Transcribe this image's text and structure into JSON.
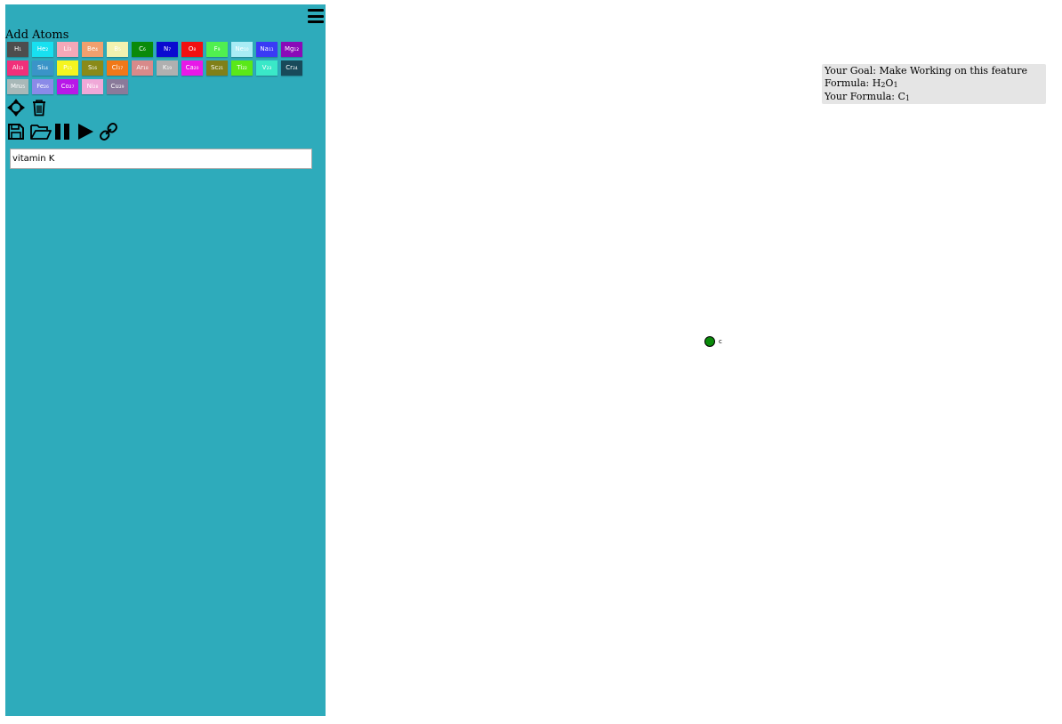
{
  "sidebar": {
    "background": "#2eabbb",
    "add_atoms_title": "Add Atoms",
    "atom_rows": [
      [
        {
          "label": "H₁",
          "bg": "#4d4d4d",
          "fg": "#ffffff"
        },
        {
          "label": "He₂",
          "bg": "#18e0f0",
          "fg": "#ffffff"
        },
        {
          "label": "Li₃",
          "bg": "#f5a8b8",
          "fg": "#ffffff"
        },
        {
          "label": "Be₄",
          "bg": "#f2a06e",
          "fg": "#ffffff"
        },
        {
          "label": "B₅",
          "bg": "#f2f2b0",
          "fg": "#ffffff"
        },
        {
          "label": "C₆",
          "bg": "#0a8a0a",
          "fg": "#ffffff"
        },
        {
          "label": "N₇",
          "bg": "#0a0ad0",
          "fg": "#ffffff"
        },
        {
          "label": "O₈",
          "bg": "#f01010",
          "fg": "#ffffff"
        },
        {
          "label": "F₉",
          "bg": "#50f050",
          "fg": "#ffffff"
        },
        {
          "label": "Ne₁₀",
          "bg": "#a8ecf5",
          "fg": "#ffffff"
        },
        {
          "label": "Na₁₁",
          "bg": "#3a3af5",
          "fg": "#ffffff"
        },
        {
          "label": "Mg₁₂",
          "bg": "#8a0ab8",
          "fg": "#ffffff"
        }
      ],
      [
        {
          "label": "Al₁₃",
          "bg": "#f0307a",
          "fg": "#ffffff"
        },
        {
          "label": "Si₁₄",
          "bg": "#3a94c8",
          "fg": "#ffffff"
        },
        {
          "label": "P₁₅",
          "bg": "#f5f520",
          "fg": "#ffffff"
        },
        {
          "label": "S₁₆",
          "bg": "#8a8a18",
          "fg": "#ffffff"
        },
        {
          "label": "Cl₁₇",
          "bg": "#f07818",
          "fg": "#ffffff"
        },
        {
          "label": "Ar₁₈",
          "bg": "#d88a8a",
          "fg": "#ffffff"
        },
        {
          "label": "K₁₉",
          "bg": "#b0b0b0",
          "fg": "#ffffff"
        },
        {
          "label": "Ca₂₀",
          "bg": "#e818e8",
          "fg": "#ffffff"
        },
        {
          "label": "Sc₂₁",
          "bg": "#808018",
          "fg": "#ffffff"
        },
        {
          "label": "Ti₂₂",
          "bg": "#5ae818",
          "fg": "#ffffff"
        },
        {
          "label": "V₂₃",
          "bg": "#3ae8c8",
          "fg": "#ffffff"
        },
        {
          "label": "Cr₂₄",
          "bg": "#184a5a",
          "fg": "#ffffff"
        }
      ],
      [
        {
          "label": "Mn₂₅",
          "bg": "#a8b8b8",
          "fg": "#ffffff"
        },
        {
          "label": "Fe₂₆",
          "bg": "#8a8ae8",
          "fg": "#ffffff"
        },
        {
          "label": "Co₂₇",
          "bg": "#b818e8",
          "fg": "#ffffff"
        },
        {
          "label": "Ni₂₈",
          "bg": "#f0a8d8",
          "fg": "#ffffff"
        },
        {
          "label": "Cu₂₉",
          "bg": "#8a7a9a",
          "fg": "#ffffff"
        }
      ]
    ],
    "tools_row1": [
      "move-icon",
      "trash-icon"
    ],
    "tools_row2": [
      "save-icon",
      "open-folder-icon",
      "pause-icon",
      "play-icon",
      "link-icon"
    ],
    "search_value": "vitamin K"
  },
  "goal": {
    "line1": "Your Goal: Make Working on this feature",
    "formula_prefix": "Formula: ",
    "formula_parts": [
      {
        "el": "H",
        "n": "2"
      },
      {
        "el": "O",
        "n": "1"
      }
    ],
    "your_prefix": "Your Formula: ",
    "your_parts": [
      {
        "el": "C",
        "n": "1"
      }
    ]
  },
  "canvas": {
    "atom_label": "c",
    "atom_color": "#0a8a0a"
  }
}
